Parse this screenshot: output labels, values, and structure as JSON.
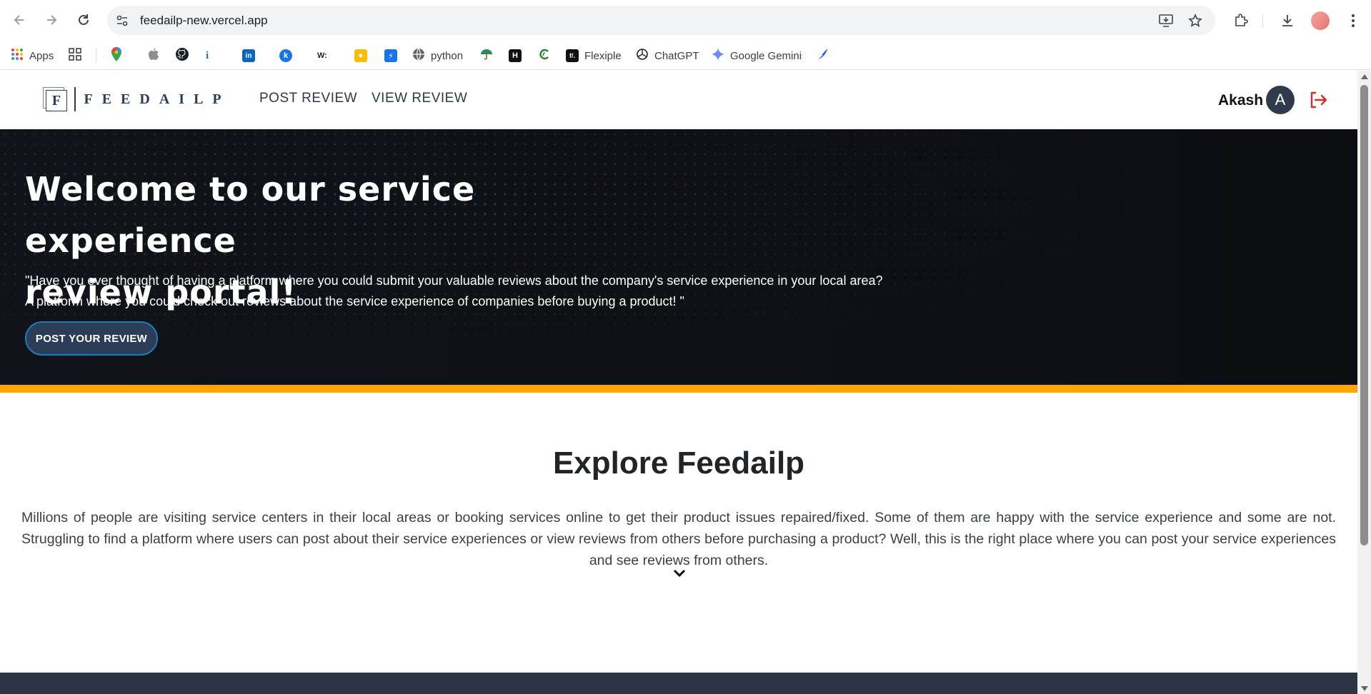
{
  "browser": {
    "url": "feedailp-new.vercel.app",
    "bookmarks": [
      {
        "label": "Apps",
        "icon": "apps-grid-icon"
      },
      {
        "label": "",
        "icon": "grid-icon"
      },
      {
        "label": "",
        "icon": "maps-pin-icon"
      },
      {
        "label": "",
        "icon": "apple-icon"
      },
      {
        "label": "",
        "icon": "github-icon"
      },
      {
        "label": "",
        "icon": "info-icon"
      },
      {
        "label": "",
        "icon": "linkedin-icon"
      },
      {
        "label": "",
        "icon": "k-circle-icon"
      },
      {
        "label": "",
        "icon": "w-icon"
      },
      {
        "label": "",
        "icon": "keep-icon"
      },
      {
        "label": "",
        "icon": "lightning-icon"
      },
      {
        "label": "python",
        "icon": "globe-icon"
      },
      {
        "label": "",
        "icon": "umbrella-icon"
      },
      {
        "label": "",
        "icon": "hackerrank-icon"
      },
      {
        "label": "",
        "icon": "c-refresh-icon"
      },
      {
        "label": "Flexiple",
        "icon": "flexiple-icon"
      },
      {
        "label": "ChatGPT",
        "icon": "chatgpt-icon"
      },
      {
        "label": "Google Gemini",
        "icon": "gemini-icon"
      },
      {
        "label": "",
        "icon": "feather-icon"
      }
    ]
  },
  "site": {
    "logo_letter": "F",
    "logo_text": "FEEDAILP",
    "nav": {
      "post_review": "POST REVIEW",
      "view_review": "VIEW REVIEW"
    },
    "user": {
      "name": "Akash",
      "avatar_letter": "A"
    }
  },
  "hero": {
    "title_line1": "Welcome to our service experience",
    "title_line2": "review portal!",
    "quote_line1": "\"Have you ever thought of having a platform where you could submit your valuable reviews about the company's service experience in your local area?",
    "quote_line2": "A platform where you could check out reviews about the service experience of companies before buying a product! \"",
    "button": "POST YOUR REVIEW"
  },
  "explore": {
    "title": "Explore Feedailp",
    "text": "Millions of people are visiting service centers in their local areas or booking services online to get their product issues repaired/fixed. Some of them are happy with the service experience and some are not. Struggling to find a platform where users can post about their service experiences or view reviews from others before purchasing a product? Well, this is the right place where you can post your service experiences and see reviews from others."
  },
  "colors": {
    "accent": "#ffa500",
    "navy": "#2c3e57",
    "logout": "#d32f2f"
  }
}
